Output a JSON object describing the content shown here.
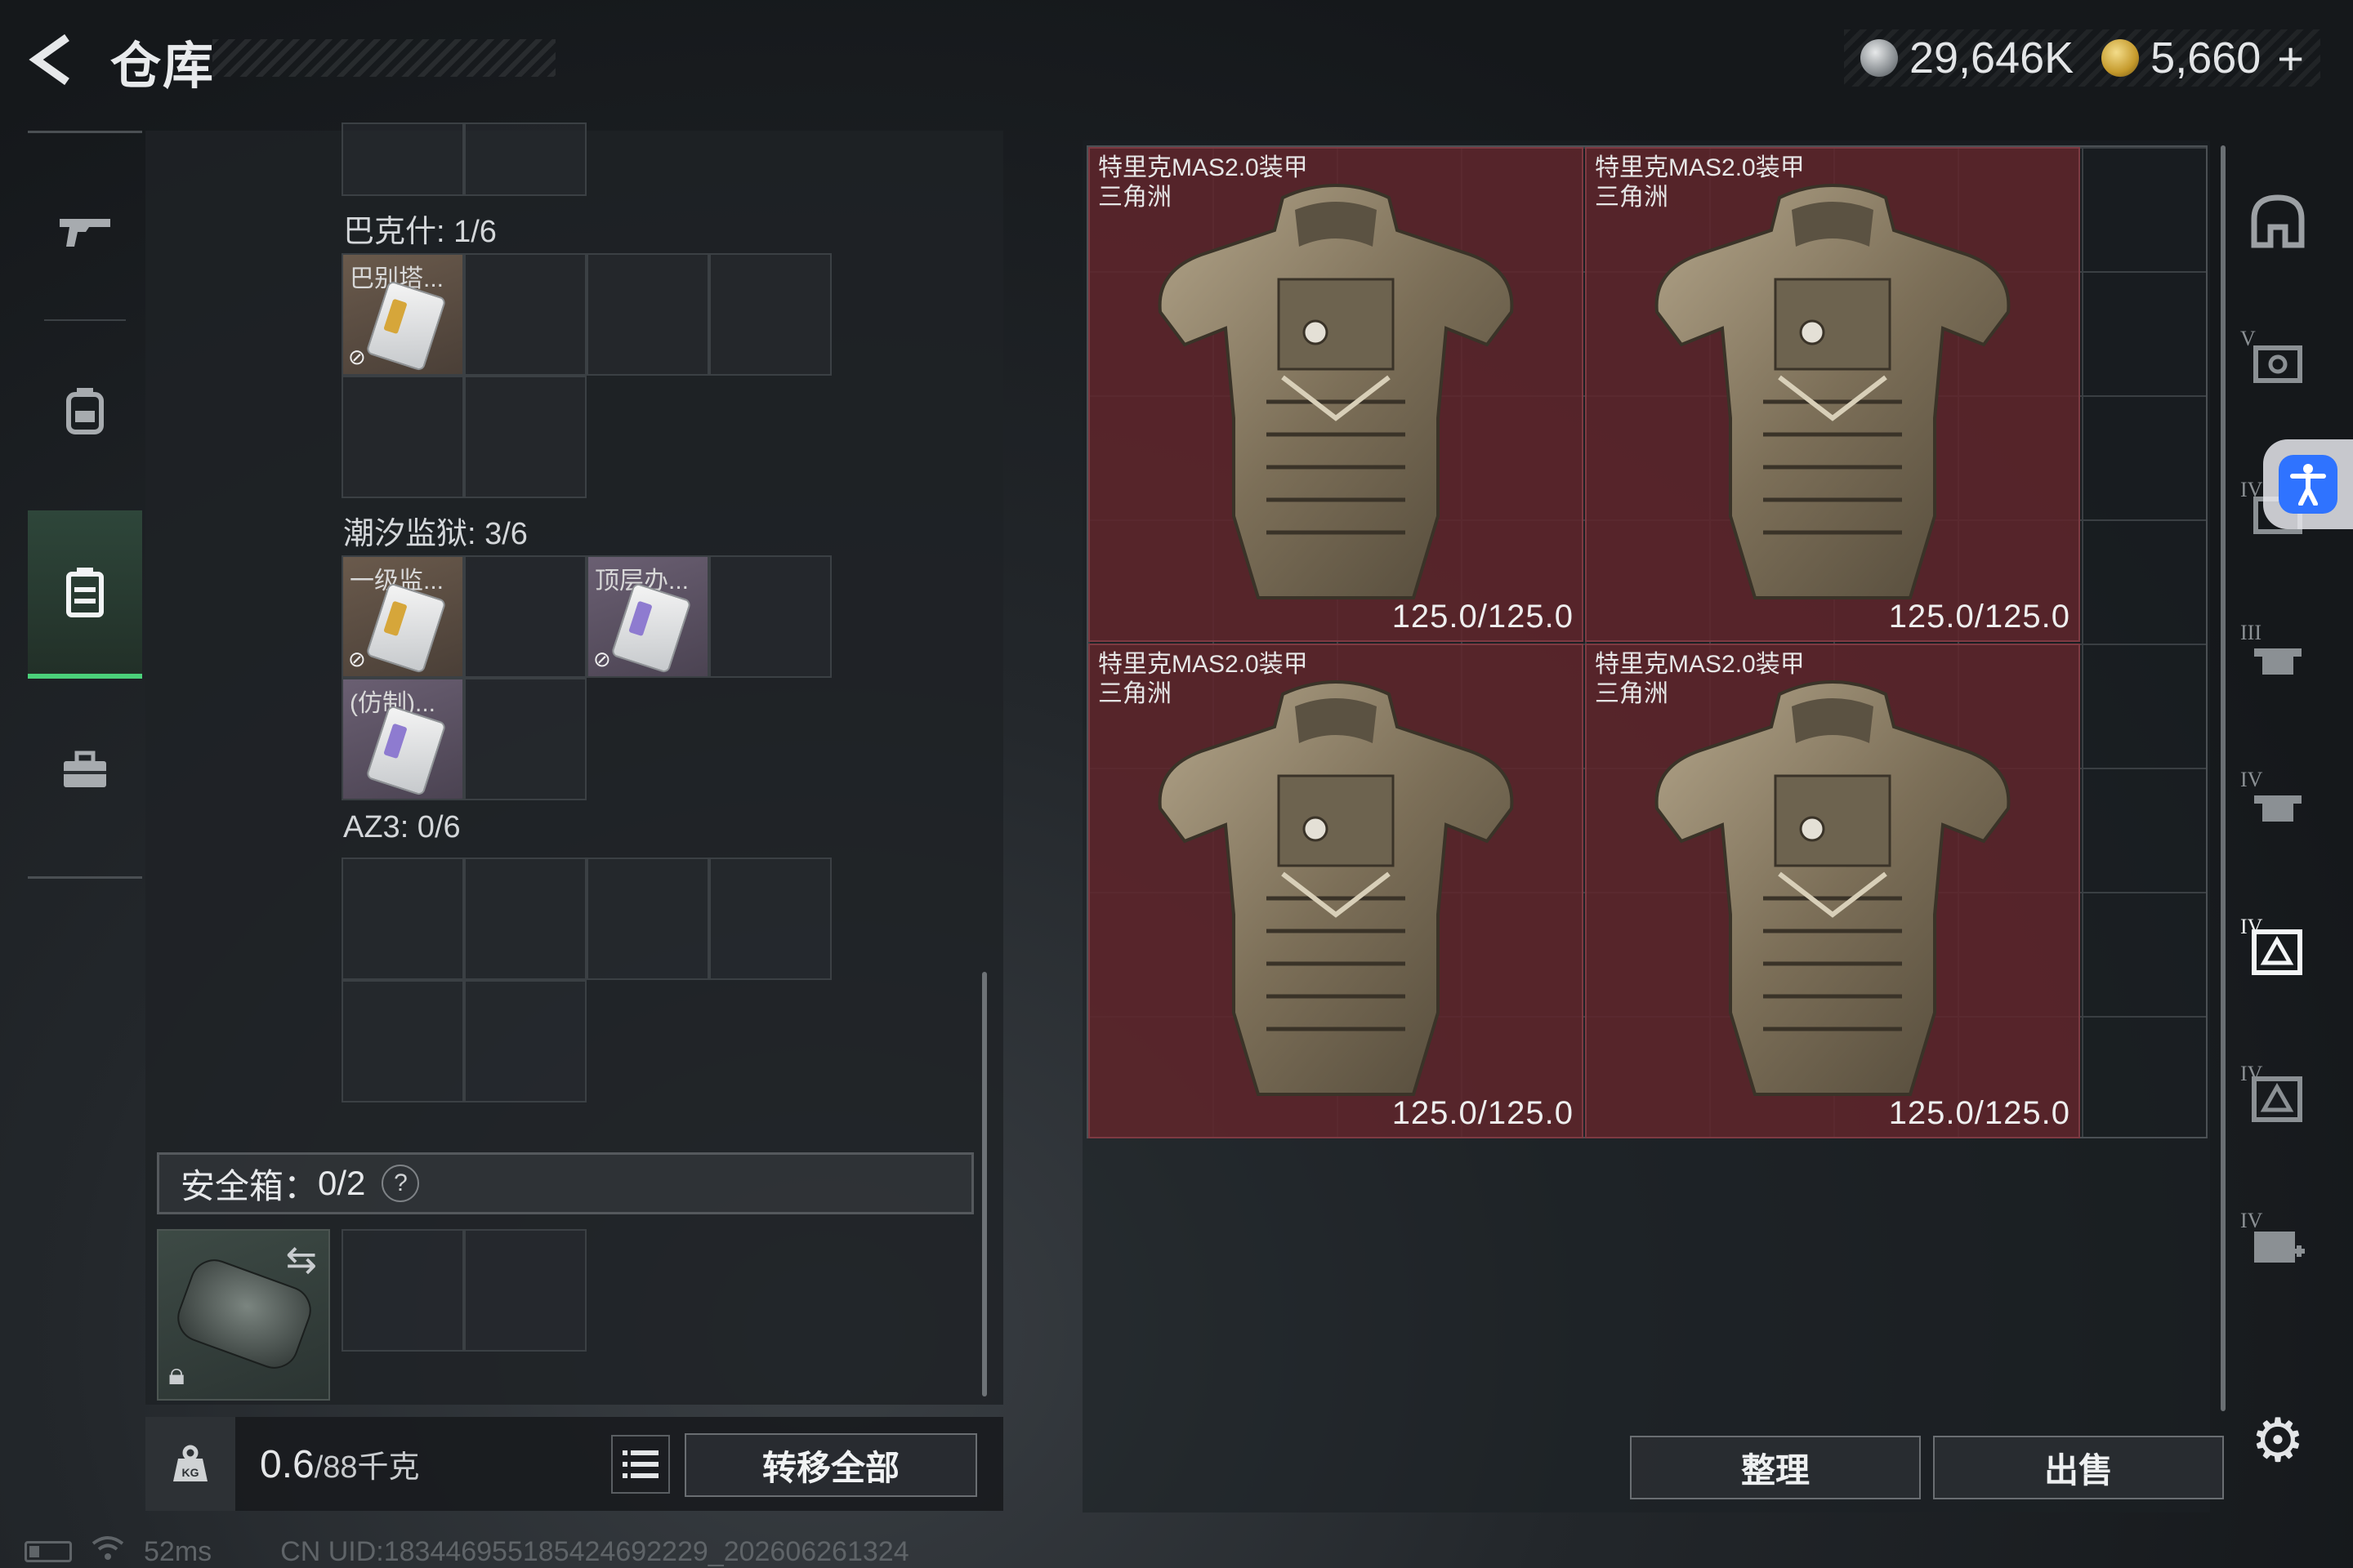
{
  "header": {
    "title": "仓库",
    "currency_silver": "29,646K",
    "currency_gold": "5,660",
    "plus": "+"
  },
  "leftnav": {
    "items": [
      {
        "name": "weapons",
        "icon": "rifle-icon"
      },
      {
        "name": "gear",
        "icon": "backpack-icon"
      },
      {
        "name": "storage",
        "icon": "case-icon",
        "active": true
      },
      {
        "name": "toolbox",
        "icon": "toolbox-icon"
      }
    ]
  },
  "storage": {
    "sections": [
      {
        "label": "巴克什: 1/6",
        "items": [
          {
            "label": "巴别塔..."
          }
        ]
      },
      {
        "label": "潮汐监狱: 3/6",
        "items": [
          {
            "label": "一级监..."
          },
          {
            "label": "顶层办..."
          },
          {
            "label": "(仿制)..."
          }
        ]
      },
      {
        "label": "AZ3: 0/6",
        "items": []
      }
    ],
    "safebox_label": "安全箱：",
    "safebox_count": "0/2",
    "safebox_help": "?"
  },
  "weight": {
    "current": "0.6",
    "max": "/88千克",
    "kg_label": "KG"
  },
  "buttons": {
    "transfer_all": "转移全部",
    "organize": "整理",
    "sell": "出售"
  },
  "grid_items": [
    {
      "name": "特里克MAS2.0装甲",
      "map": "三角洲",
      "durability": "125.0/125.0"
    },
    {
      "name": "特里克MAS2.0装甲",
      "map": "三角洲",
      "durability": "125.0/125.0"
    },
    {
      "name": "特里克MAS2.0装甲",
      "map": "三角洲",
      "durability": "125.0/125.0"
    },
    {
      "name": "特里克MAS2.0装甲",
      "map": "三角洲",
      "durability": "125.0/125.0"
    }
  ],
  "filters": [
    {
      "tier": "",
      "icon": "helmet-icon"
    },
    {
      "tier": "V",
      "icon": "vest-icon"
    },
    {
      "tier": "IV",
      "icon": "vest-icon"
    },
    {
      "tier": "III",
      "icon": "rig-icon"
    },
    {
      "tier": "IV",
      "icon": "rig-icon"
    },
    {
      "tier": "IV",
      "icon": "triangle-vest-icon",
      "active": true
    },
    {
      "tier": "IV",
      "icon": "triangle-vest-icon"
    },
    {
      "tier": "IV",
      "icon": "medkit-icon"
    }
  ],
  "status": {
    "ping": "52ms",
    "uid": "CN UID:1834469551854246922​29_202606261324"
  },
  "colors": {
    "accent_green": "#4bd17a",
    "item_bg": "#60262c",
    "access_blue": "#2f73ff"
  }
}
